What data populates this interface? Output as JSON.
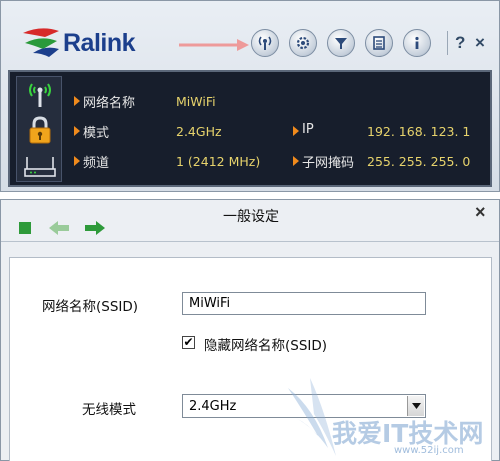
{
  "app": {
    "logo_text": "Ralink",
    "help_label": "?",
    "close_label": "×"
  },
  "toolbar": {
    "buttons": [
      {
        "icon": "antenna-icon"
      },
      {
        "icon": "gear-icon"
      },
      {
        "icon": "filter-icon"
      },
      {
        "icon": "list-icon"
      },
      {
        "icon": "info-icon"
      }
    ]
  },
  "status": {
    "network_name_label": "网络名称",
    "network_name_value": "MiWiFi",
    "mode_label": "模式",
    "mode_value": "2.4GHz",
    "channel_label": "频道",
    "channel_value": "1 (2412 MHz)",
    "ip_label": "IP",
    "ip_value": "192. 168. 123. 1",
    "subnet_label": "子网掩码",
    "subnet_value": "255. 255. 255. 0"
  },
  "dialog": {
    "title": "一般设定",
    "close_label": "×",
    "ssid_label": "网络名称(SSID)",
    "ssid_value": "MiWiFi",
    "hide_ssid_label": "隐藏网络名称(SSID)",
    "hide_ssid_checked": "✔",
    "wireless_mode_label": "无线模式",
    "wireless_mode_value": "2.4GHz"
  },
  "watermark": {
    "text": "我爱IT技术网",
    "url": "www.52ij.com"
  },
  "colors": {
    "panel_bg": "#171e2c",
    "value_yellow": "#e7d36c",
    "bullet_orange": "#f08a1c",
    "logo_blue": "#1c3f8c",
    "nav_green": "#2e9a3a",
    "arrow_red": "#ee9a9a"
  }
}
